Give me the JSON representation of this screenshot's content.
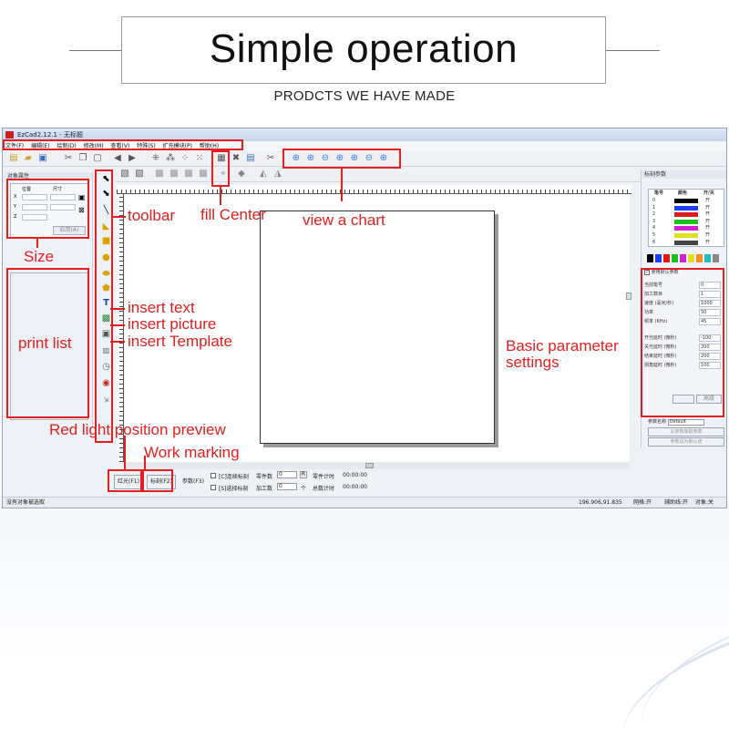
{
  "header": {
    "title": "Simple operation",
    "subtitle": "PRODCTS WE HAVE MADE"
  },
  "window": {
    "title": "EzCad2.12.1 - 无标题",
    "menu": [
      "文件(F)",
      "编辑(E)",
      "绘制(D)",
      "修改(M)",
      "查看(V)",
      "特殊(S)",
      "扩充模块(P)",
      "帮助(H)"
    ],
    "left_panel": {
      "title": "对象属性",
      "pos_label": "位置",
      "size_label": "尺寸",
      "axis_x": "X",
      "axis_y": "Y",
      "axis_z": "Z",
      "apply_button": "应用(A)"
    },
    "bottom": {
      "red_light_button": "红光(F1)",
      "mark_button": "标刻(F2)",
      "param_button": "参数(F3)",
      "continuous_label": "[C]连续标刻",
      "select_label": "[S]选择标刻",
      "part_count_label": "零件数",
      "part_count_value": "0",
      "processed_label": "加工数",
      "processed_value": "0",
      "part_time_label": "零件计时",
      "part_time_value": "00:00:00",
      "total_time_label": "总数计时",
      "total_time_value": "00:00:00",
      "unit": "个",
      "reset_label": "R"
    },
    "status": {
      "left": "没有对象被选取",
      "coords": "196.906,91.835",
      "grid": "网格:开",
      "guide": "辅助线:开",
      "object": "对象:关"
    },
    "right_panel": {
      "title": "标刻参数",
      "col_pen": "笔号",
      "col_color": "颜色",
      "col_onoff": "开/关",
      "pens": [
        {
          "no": "0",
          "color": "#000000",
          "state": "开"
        },
        {
          "no": "1",
          "color": "#1a3cff",
          "state": "开"
        },
        {
          "no": "2",
          "color": "#e01818",
          "state": "开"
        },
        {
          "no": "3",
          "color": "#18c018",
          "state": "开"
        },
        {
          "no": "4",
          "color": "#d020d0",
          "state": "开"
        },
        {
          "no": "5",
          "color": "#e0e020",
          "state": "开"
        },
        {
          "no": "6",
          "color": "#444444",
          "state": "开"
        }
      ],
      "palette": [
        "#000000",
        "#1a3cff",
        "#e01818",
        "#18c018",
        "#d020d0",
        "#e0e020",
        "#ff8a20",
        "#20c0c0",
        "#888888"
      ],
      "use_default": "使用默认参数",
      "params": [
        {
          "label": "当前笔号",
          "value": "0"
        },
        {
          "label": "加工数目",
          "value": "1"
        },
        {
          "label": "速度 (毫米/秒)",
          "value": "1000"
        },
        {
          "label": "功率",
          "value": "50"
        },
        {
          "label": "频率 (KHz)",
          "value": "45"
        },
        {
          "label": "开光延时 (微秒)",
          "value": "-100"
        },
        {
          "label": "关光延时 (微秒)",
          "value": "200"
        },
        {
          "label": "结束延时 (微秒)",
          "value": "200"
        },
        {
          "label": "拐角延时 (微秒)",
          "value": "100"
        }
      ],
      "adv_button": "高级",
      "param_name_label": "参数名称",
      "param_name_value": "Default",
      "load_button": "从参数库取参数",
      "save_button": "参数设为默认值"
    }
  },
  "annotations": {
    "toolbar": "toolbar",
    "fill_center": "fill Center",
    "view_chart": "view a chart",
    "size": "Size",
    "print_list": "print list",
    "insert_text": "insert text",
    "insert_picture": "insert picture",
    "insert_template": "insert Template",
    "basic_param": "Basic parameter\nsettings",
    "red_light": "Red light position preview",
    "work_marking": "Work marking"
  },
  "colors": {
    "annotation": "#e41e1e",
    "window_border": "#8da2c0"
  }
}
